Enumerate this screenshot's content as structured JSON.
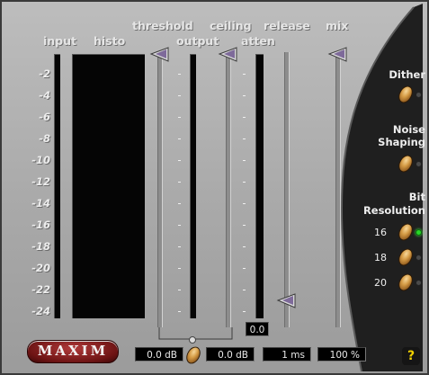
{
  "plugin": {
    "name": "MAXIM",
    "labels": {
      "input": "input",
      "histo": "histo",
      "threshold": "threshold",
      "output": "output",
      "ceiling": "ceiling",
      "atten": "atten",
      "release": "release",
      "mix": "mix"
    },
    "scale": [
      "-2",
      "-4",
      "-6",
      "-8",
      "-10",
      "-12",
      "-14",
      "-16",
      "-18",
      "-20",
      "-22",
      "-24"
    ],
    "atten_readout": "0.0",
    "readouts": {
      "threshold": "0.0 dB",
      "ceiling": "0.0 dB",
      "release": "1 ms",
      "mix": "100 %"
    },
    "side": {
      "dither": "Dither",
      "noise_shaping_1": "Noise",
      "noise_shaping_2": "Shaping",
      "bit_res_1": "Bit",
      "bit_res_2": "Resolution",
      "bit_options": [
        "16",
        "18",
        "20"
      ],
      "bit_selected": "16"
    },
    "help": "?",
    "colors": {
      "panel": "#a9a9a9",
      "side_panel": "#1f1f1f",
      "logo_red": "#7a1a1a",
      "knob_gold": "#d49a44",
      "led_on": "#27d627",
      "help_yellow": "#f0d000"
    }
  }
}
